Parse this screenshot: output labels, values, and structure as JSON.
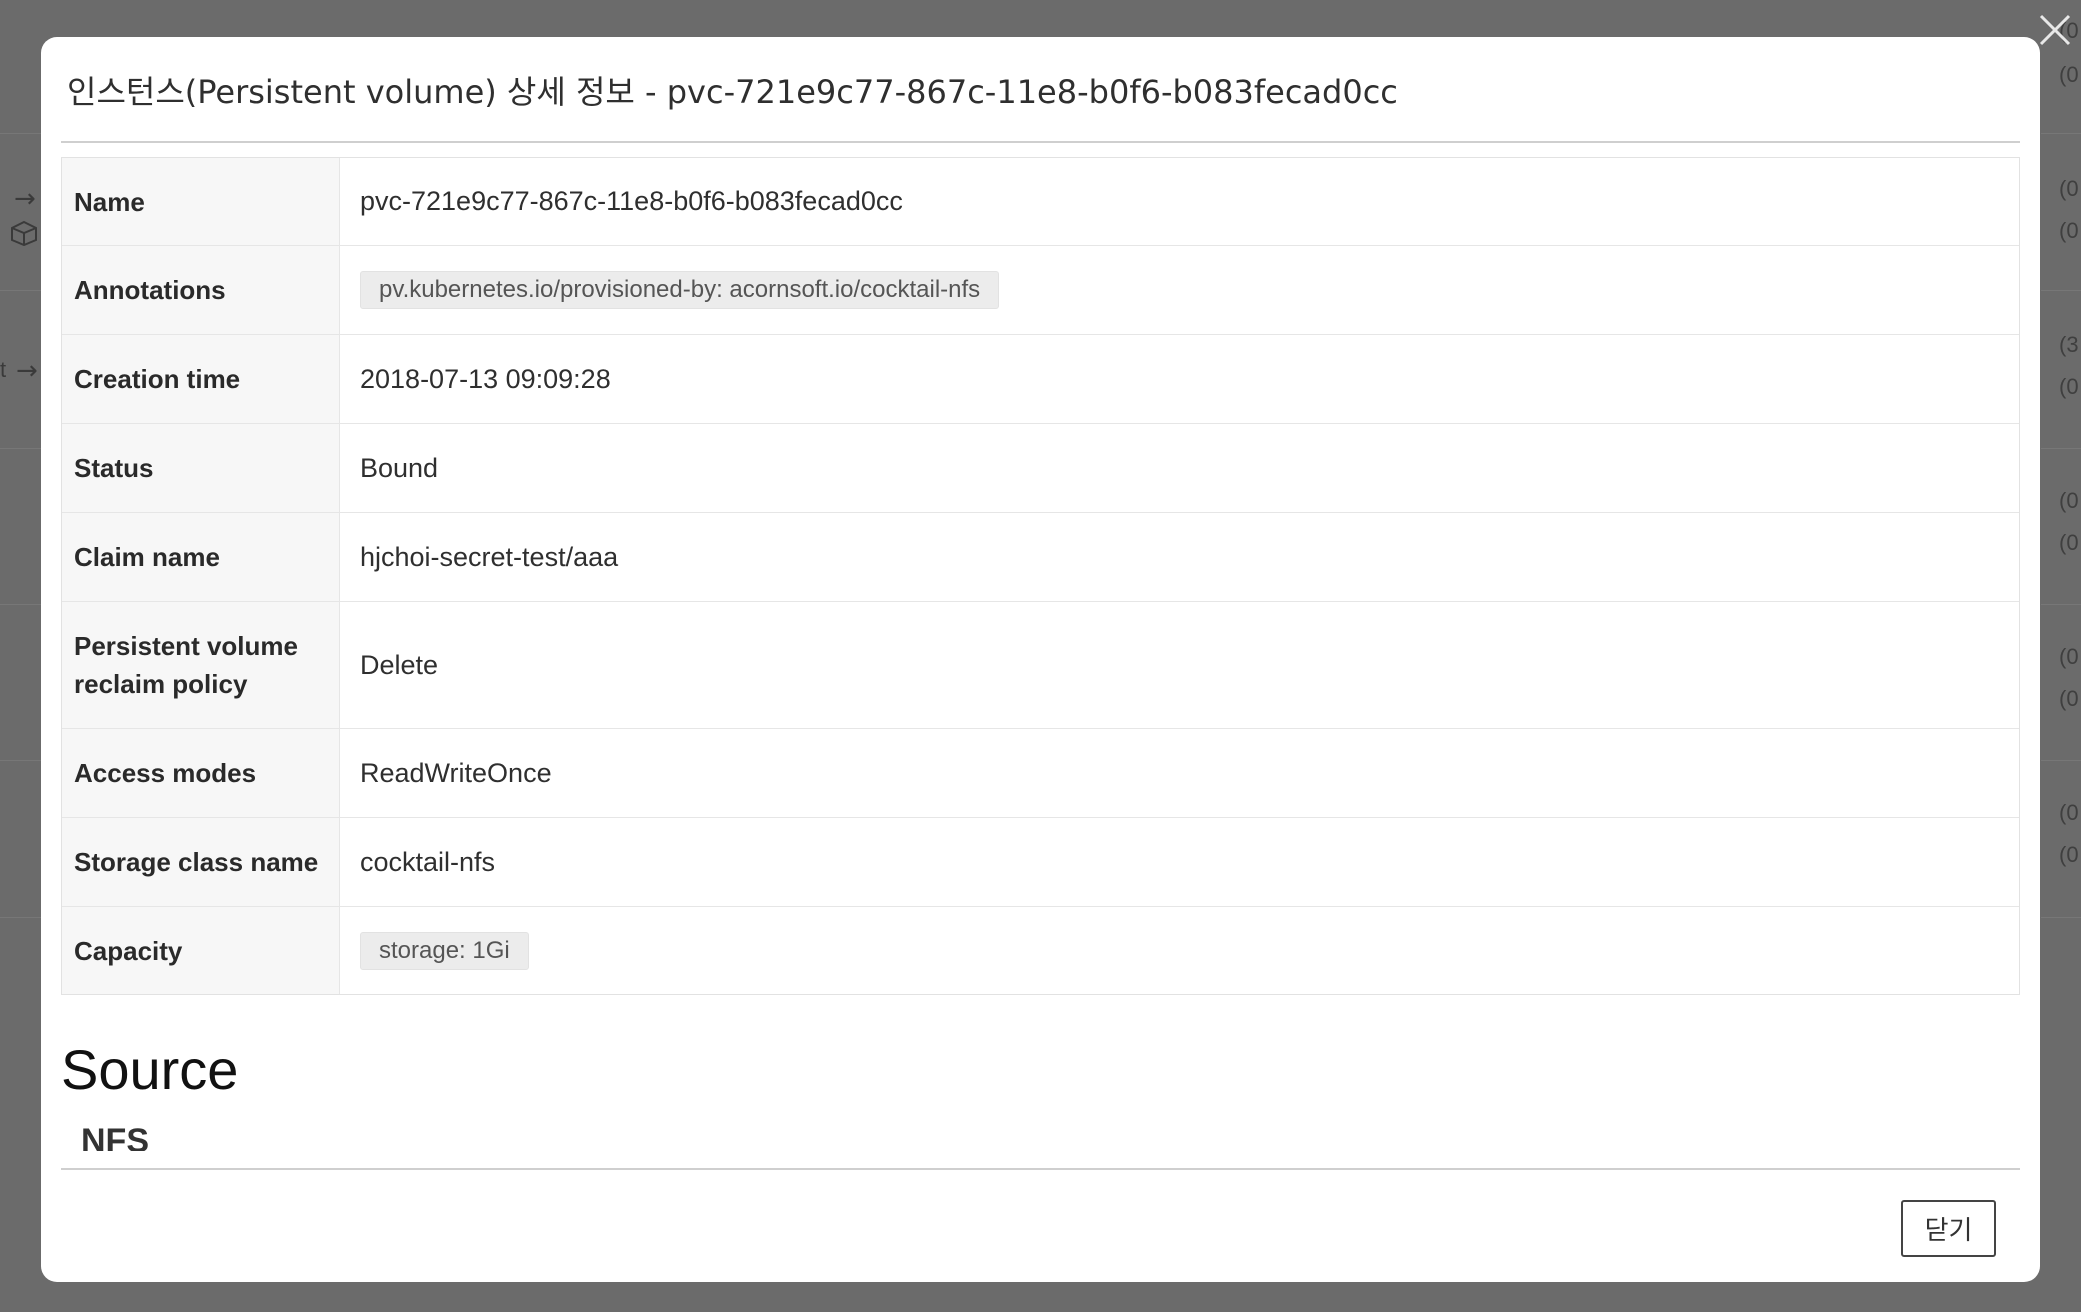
{
  "modal": {
    "title": "인스턴스(Persistent volume) 상세 정보 - pvc-721e9c77-867c-11e8-b0f6-b083fecad0cc",
    "rows": [
      {
        "label": "Name",
        "value": "pvc-721e9c77-867c-11e8-b0f6-b083fecad0cc",
        "type": "text"
      },
      {
        "label": "Annotations",
        "value": "pv.kubernetes.io/provisioned-by: acornsoft.io/cocktail-nfs",
        "type": "tag"
      },
      {
        "label": "Creation time",
        "value": "2018-07-13 09:09:28",
        "type": "text"
      },
      {
        "label": "Status",
        "value": "Bound",
        "type": "text"
      },
      {
        "label": "Claim name",
        "value": "hjchoi-secret-test/aaa",
        "type": "text"
      },
      {
        "label": "Persistent volume reclaim policy",
        "value": "Delete",
        "type": "text"
      },
      {
        "label": "Access modes",
        "value": "ReadWriteOnce",
        "type": "text"
      },
      {
        "label": "Storage class name",
        "value": "cocktail-nfs",
        "type": "text"
      },
      {
        "label": "Capacity",
        "value": "storage: 1Gi",
        "type": "tag"
      }
    ],
    "section_title": "Source",
    "subsection_title": "NFS",
    "close_button_label": "닫기"
  },
  "background": {
    "left_fragments": [
      "t"
    ],
    "right_fragments": [
      "(0",
      "(0",
      "(0",
      "(0",
      "(3",
      "(0",
      "(0",
      "(0",
      "(0",
      "(0",
      "(0",
      "(0"
    ]
  },
  "icons": {
    "modal_close": "close-icon",
    "bg_arrow": "arrow-right-icon",
    "bg_cube": "cube-icon"
  }
}
